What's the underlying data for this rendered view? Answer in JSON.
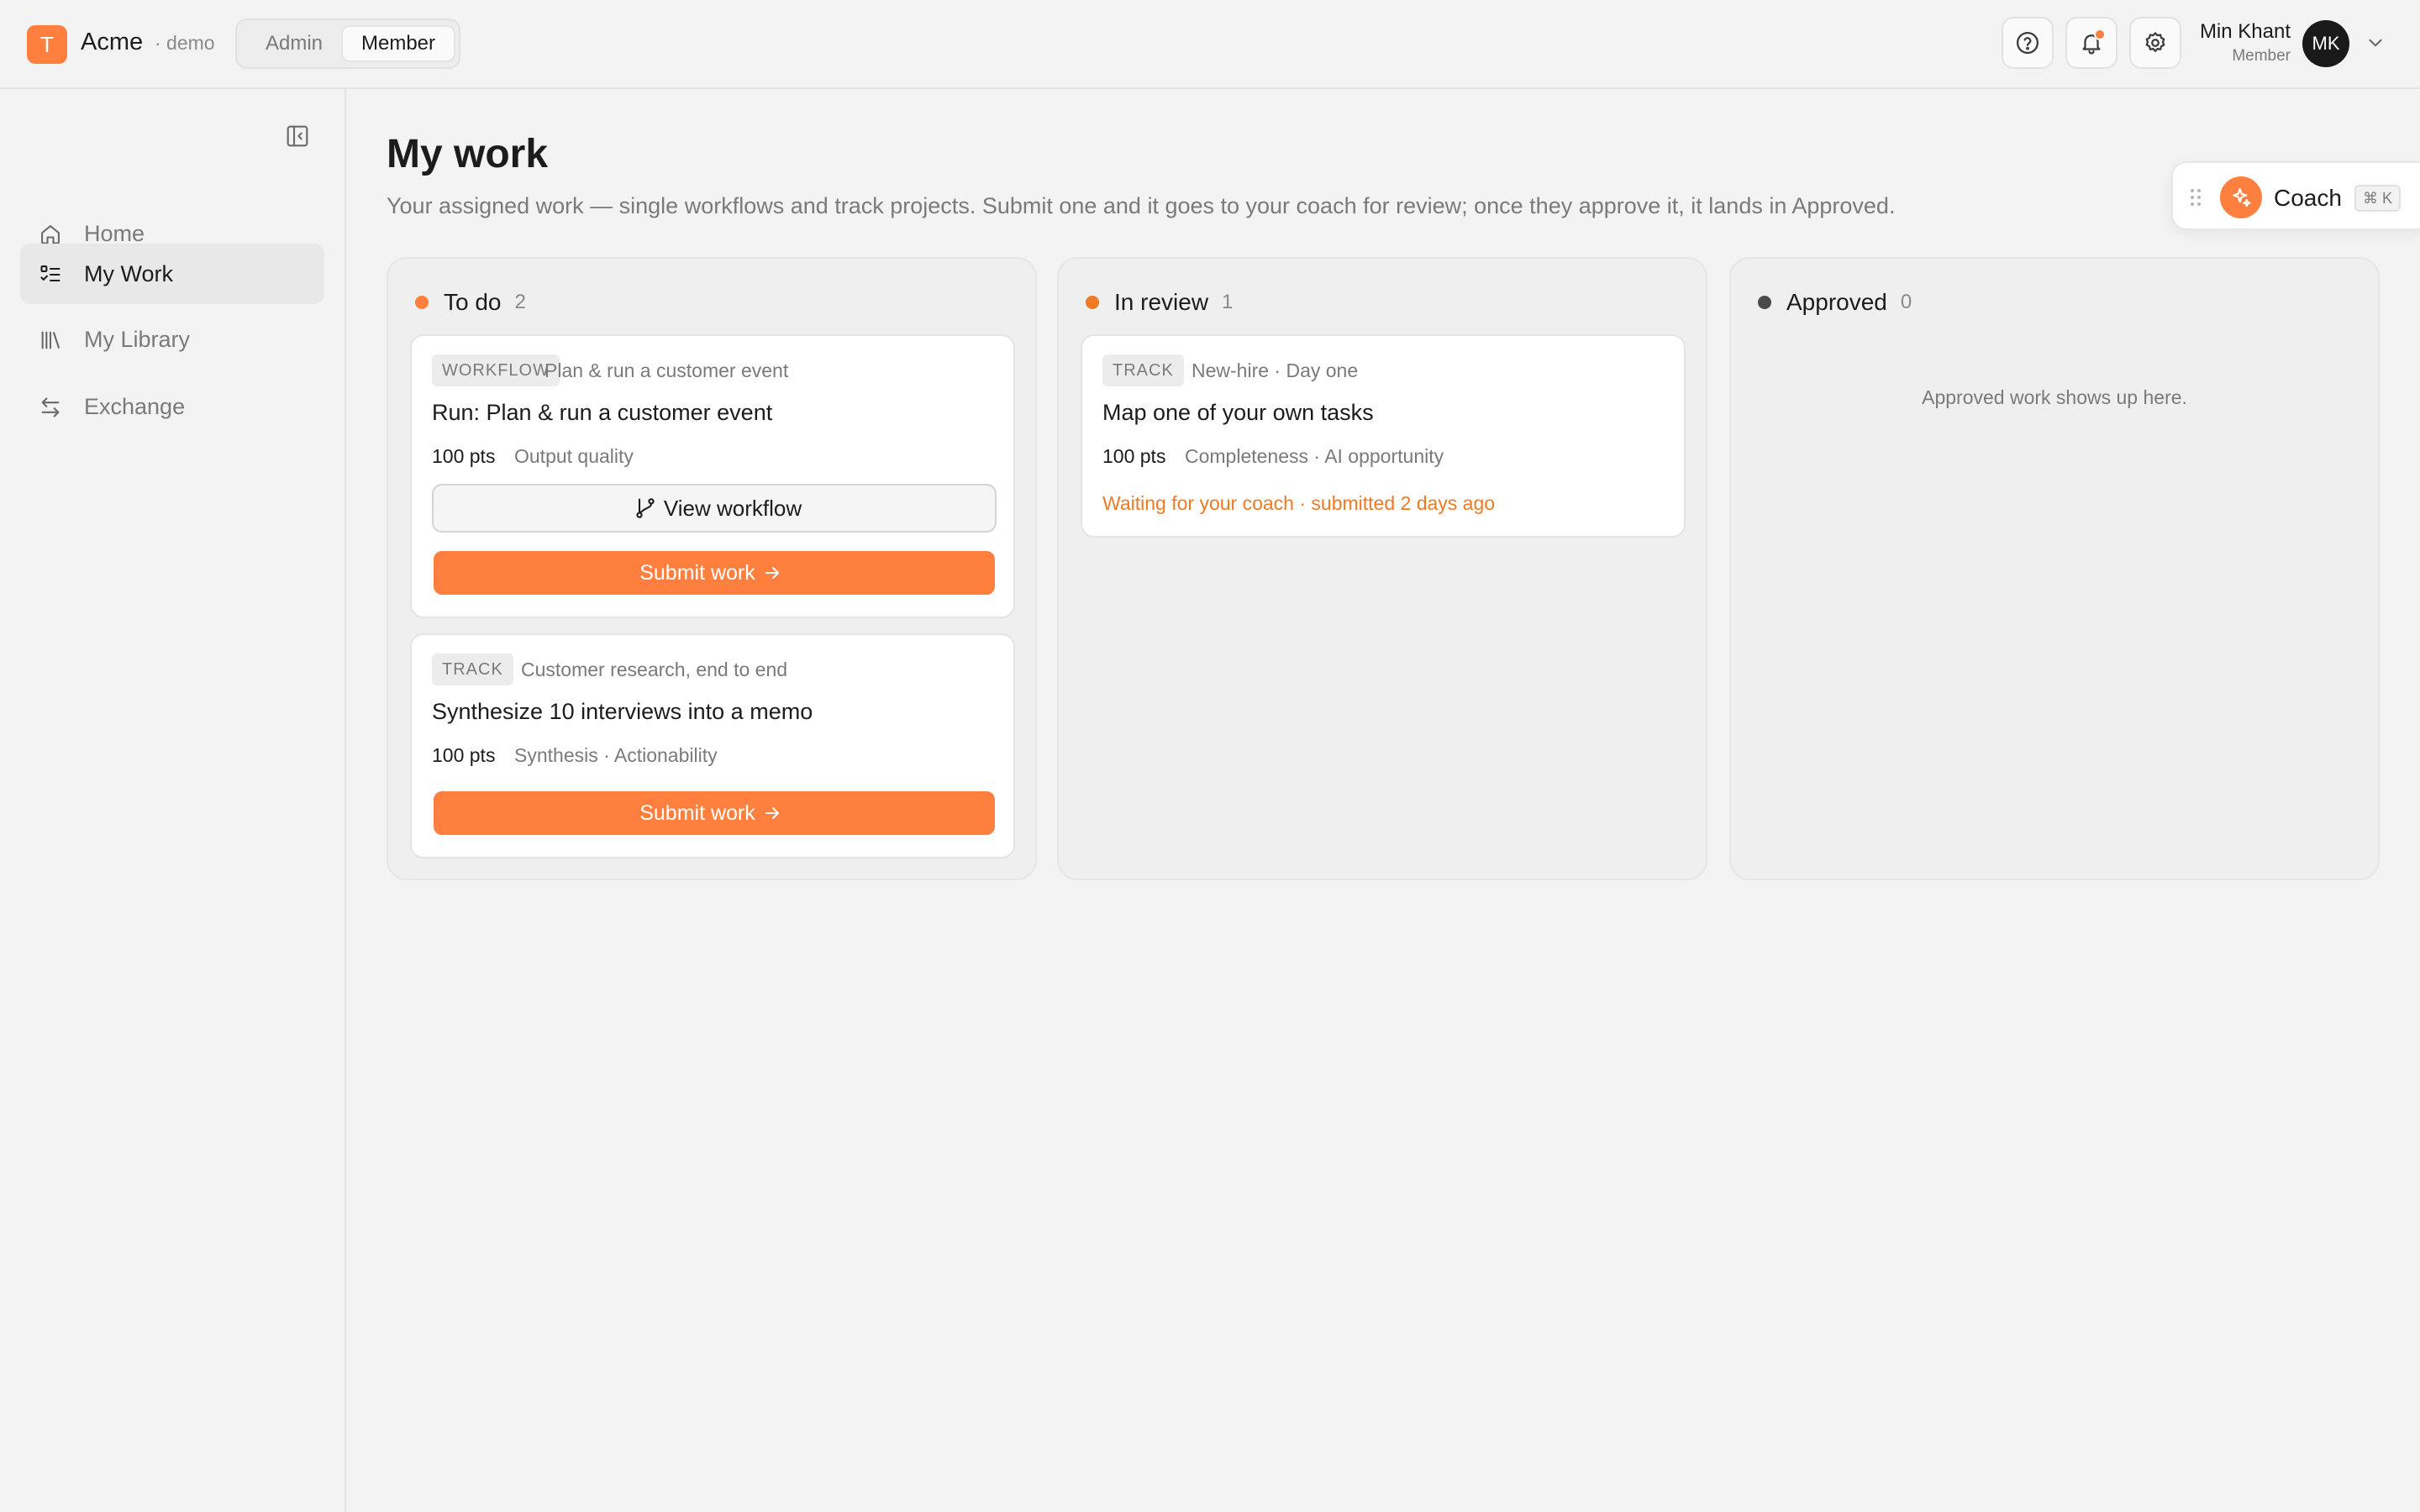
{
  "brand": {
    "logo_letter": "T",
    "name": "Acme",
    "env": "· demo",
    "accent": "#ff7f3f"
  },
  "role_switch": {
    "options": [
      "Admin",
      "Member"
    ],
    "selected": "Member"
  },
  "topbar": {
    "icons": [
      "help-icon",
      "bell-icon",
      "gear-icon"
    ],
    "user": {
      "name": "Min Khant",
      "role": "Member",
      "initials": "MK"
    }
  },
  "sidebar": {
    "items": [
      {
        "label": "Home",
        "icon": "home-icon",
        "active": false
      },
      {
        "label": "My Work",
        "icon": "checklist-icon",
        "active": true
      },
      {
        "label": "My Library",
        "icon": "library-icon",
        "active": false
      },
      {
        "label": "Exchange",
        "icon": "exchange-icon",
        "active": false
      }
    ]
  },
  "page": {
    "title": "My work",
    "subtitle": "Your assigned work — single workflows and track projects. Submit one and it goes to your coach for review; once they approve it, it lands in Approved."
  },
  "columns": [
    {
      "title": "To do",
      "count": "2",
      "dot_color": "#ff7f3f",
      "cards": [
        {
          "tag": "WORKFLOW",
          "context": "Plan & run a customer event",
          "title": "Run: Plan & run a customer event",
          "points": "100 pts",
          "criteria": "Output quality",
          "secondary_action": "View workflow",
          "primary_action": "Submit work"
        },
        {
          "tag": "TRACK",
          "context": "Customer research, end to end",
          "title": "Synthesize 10 interviews into a memo",
          "points": "100 pts",
          "criteria": "Synthesis · Actionability",
          "primary_action": "Submit work"
        }
      ]
    },
    {
      "title": "In review",
      "count": "1",
      "dot_color": "#ef7a24",
      "cards": [
        {
          "tag": "TRACK",
          "context": "New-hire · Day one",
          "title": "Map one of your own tasks",
          "points": "100 pts",
          "criteria": "Completeness · AI opportunity",
          "status": "Waiting for your coach · submitted 2 days ago",
          "status_color": "#ef7a24"
        }
      ]
    },
    {
      "title": "Approved",
      "count": "0",
      "dot_color": "#4a4a4a",
      "empty_message": "Approved work shows up here."
    }
  ],
  "coach": {
    "label": "Coach",
    "shortcut": "⌘ K"
  }
}
